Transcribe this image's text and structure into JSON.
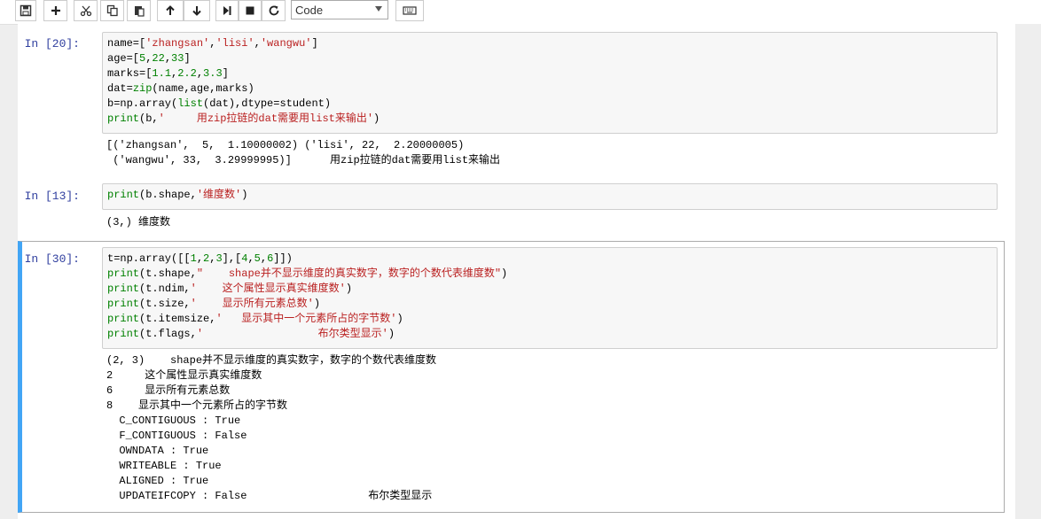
{
  "toolbar": {
    "buttons": [
      "save-icon",
      "plus-icon",
      "scissors-icon",
      "copy-icon",
      "paste-icon",
      "arrow-up-icon",
      "arrow-down-icon",
      "step-forward-icon",
      "stop-icon",
      "refresh-icon"
    ],
    "cell_type": "Code",
    "keyboard": "keyboard-icon"
  },
  "cells": [
    {
      "prompt": "In  [20]:",
      "code": [
        [
          {
            "t": "name=[",
            "c": ""
          },
          {
            "t": "'zhangsan'",
            "c": "str"
          },
          {
            "t": ",",
            "c": ""
          },
          {
            "t": "'lisi'",
            "c": "str"
          },
          {
            "t": ",",
            "c": ""
          },
          {
            "t": "'wangwu'",
            "c": "str"
          },
          {
            "t": "]",
            "c": ""
          }
        ],
        [
          {
            "t": "age=[",
            "c": ""
          },
          {
            "t": "5",
            "c": "num"
          },
          {
            "t": ",",
            "c": ""
          },
          {
            "t": "22",
            "c": "num"
          },
          {
            "t": ",",
            "c": ""
          },
          {
            "t": "33",
            "c": "num"
          },
          {
            "t": "]",
            "c": ""
          }
        ],
        [
          {
            "t": "marks=[",
            "c": ""
          },
          {
            "t": "1.1",
            "c": "num"
          },
          {
            "t": ",",
            "c": ""
          },
          {
            "t": "2.2",
            "c": "num"
          },
          {
            "t": ",",
            "c": ""
          },
          {
            "t": "3.3",
            "c": "num"
          },
          {
            "t": "]",
            "c": ""
          }
        ],
        [
          {
            "t": "dat=",
            "c": ""
          },
          {
            "t": "zip",
            "c": "kw"
          },
          {
            "t": "(name,age,marks)",
            "c": ""
          }
        ],
        [
          {
            "t": "b=np.array(",
            "c": ""
          },
          {
            "t": "list",
            "c": "kw"
          },
          {
            "t": "(dat),dtype=student)",
            "c": ""
          }
        ],
        [
          {
            "t": "print",
            "c": "kw"
          },
          {
            "t": "(b,",
            "c": ""
          },
          {
            "t": "'     用zip拉链的dat需要用list来输出'",
            "c": "str"
          },
          {
            "t": ")",
            "c": ""
          }
        ]
      ],
      "output": [
        "[('zhangsan',  5,  1.10000002) ('lisi', 22,  2.20000005)",
        " ('wangwu', 33,  3.29999995)]      用zip拉链的dat需要用list来输出"
      ]
    },
    {
      "prompt": "In  [13]:",
      "code": [
        [
          {
            "t": "print",
            "c": "kw"
          },
          {
            "t": "(b.shape,",
            "c": ""
          },
          {
            "t": "'维度数'",
            "c": "str"
          },
          {
            "t": ")",
            "c": ""
          }
        ]
      ],
      "output": [
        "(3,) 维度数"
      ]
    },
    {
      "prompt": "In  [30]:",
      "code": [
        [
          {
            "t": "t=np.array([[",
            "c": ""
          },
          {
            "t": "1",
            "c": "num"
          },
          {
            "t": ",",
            "c": ""
          },
          {
            "t": "2",
            "c": "num"
          },
          {
            "t": ",",
            "c": ""
          },
          {
            "t": "3",
            "c": "num"
          },
          {
            "t": "],[",
            "c": ""
          },
          {
            "t": "4",
            "c": "num"
          },
          {
            "t": ",",
            "c": ""
          },
          {
            "t": "5",
            "c": "num"
          },
          {
            "t": ",",
            "c": ""
          },
          {
            "t": "6",
            "c": "num"
          },
          {
            "t": "]])",
            "c": ""
          }
        ],
        [
          {
            "t": "print",
            "c": "kw"
          },
          {
            "t": "(t.shape,",
            "c": ""
          },
          {
            "t": "\"    shape并不显示维度的真实数字，数字的个数代表维度数\"",
            "c": "str"
          },
          {
            "t": ")",
            "c": ""
          }
        ],
        [
          {
            "t": "print",
            "c": "kw"
          },
          {
            "t": "(t.ndim,",
            "c": ""
          },
          {
            "t": "'    这个属性显示真实维度数'",
            "c": "str"
          },
          {
            "t": ")",
            "c": ""
          }
        ],
        [
          {
            "t": "print",
            "c": "kw"
          },
          {
            "t": "(t.size,",
            "c": ""
          },
          {
            "t": "'    显示所有元素总数'",
            "c": "str"
          },
          {
            "t": ")",
            "c": ""
          }
        ],
        [
          {
            "t": "print",
            "c": "kw"
          },
          {
            "t": "(t.itemsize,",
            "c": ""
          },
          {
            "t": "'   显示其中一个元素所占的字节数'",
            "c": "str"
          },
          {
            "t": ")",
            "c": ""
          }
        ],
        [
          {
            "t": "print",
            "c": "kw"
          },
          {
            "t": "(t.flags,",
            "c": ""
          },
          {
            "t": "'                  布尔类型显示'",
            "c": "str"
          },
          {
            "t": ")",
            "c": ""
          }
        ]
      ],
      "output": [
        "(2, 3)    shape并不显示维度的真实数字，数字的个数代表维度数",
        "2     这个属性显示真实维度数",
        "6     显示所有元素总数",
        "8    显示其中一个元素所占的字节数",
        "  C_CONTIGUOUS : True",
        "  F_CONTIGUOUS : False",
        "  OWNDATA : True",
        "  WRITEABLE : True",
        "  ALIGNED : True",
        "  UPDATEIFCOPY : False                   布尔类型显示"
      ]
    }
  ]
}
